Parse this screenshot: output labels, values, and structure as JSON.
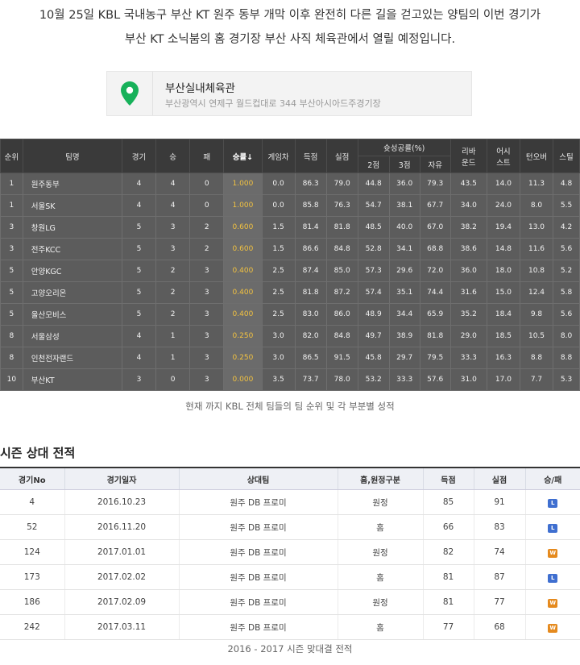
{
  "intro": {
    "line1": "10월 25일 KBL 국내농구 부산 KT 원주 동부 개막 이후 완전히 다른 길을 걷고있는 양팀의 이번 경기가",
    "line2": "부산 KT 소닉붐의 홈 경기장 부산 사직 체육관에서 열릴 예정입니다."
  },
  "venue": {
    "icon": "map-pin-icon",
    "name": "부산실내체육관",
    "address": "부산광역시 연제구 월드컵대로 344 부산아시아드주경기장"
  },
  "standings": {
    "headers": {
      "rank": "순위",
      "team": "팀명",
      "games": "경기",
      "wins": "승",
      "losses": "패",
      "pct": "승률↓",
      "gb": "게임차",
      "pf": "득점",
      "pa": "실점",
      "fg": "슛성공률(%)",
      "fg2": "2점",
      "fg3": "3점",
      "ft": "자유",
      "reb": "리바\n운드",
      "ast": "어시\n스트",
      "to": "턴오버",
      "stl": "스틸"
    },
    "rows": [
      [
        "1",
        "원주동부",
        "4",
        "4",
        "0",
        "1.000",
        "0.0",
        "86.3",
        "79.0",
        "44.8",
        "36.0",
        "79.3",
        "43.5",
        "14.0",
        "11.3",
        "4.8"
      ],
      [
        "1",
        "서울SK",
        "4",
        "4",
        "0",
        "1.000",
        "0.0",
        "85.8",
        "76.3",
        "54.7",
        "38.1",
        "67.7",
        "34.0",
        "24.0",
        "8.0",
        "5.5"
      ],
      [
        "3",
        "창원LG",
        "5",
        "3",
        "2",
        "0.600",
        "1.5",
        "81.4",
        "81.8",
        "48.5",
        "40.0",
        "67.0",
        "38.2",
        "19.4",
        "13.0",
        "4.2"
      ],
      [
        "3",
        "전주KCC",
        "5",
        "3",
        "2",
        "0.600",
        "1.5",
        "86.6",
        "84.8",
        "52.8",
        "34.1",
        "68.8",
        "38.6",
        "14.8",
        "11.6",
        "5.6"
      ],
      [
        "5",
        "안양KGC",
        "5",
        "2",
        "3",
        "0.400",
        "2.5",
        "87.4",
        "85.0",
        "57.3",
        "29.6",
        "72.0",
        "36.0",
        "18.0",
        "10.8",
        "5.2"
      ],
      [
        "5",
        "고양오리온",
        "5",
        "2",
        "3",
        "0.400",
        "2.5",
        "81.8",
        "87.2",
        "57.4",
        "35.1",
        "74.4",
        "31.6",
        "15.0",
        "12.4",
        "5.8"
      ],
      [
        "5",
        "울산모비스",
        "5",
        "2",
        "3",
        "0.400",
        "2.5",
        "83.0",
        "86.0",
        "48.9",
        "34.4",
        "65.9",
        "35.2",
        "18.4",
        "9.8",
        "5.6"
      ],
      [
        "8",
        "서울삼성",
        "4",
        "1",
        "3",
        "0.250",
        "3.0",
        "82.0",
        "84.8",
        "49.7",
        "38.9",
        "81.8",
        "29.0",
        "18.5",
        "10.5",
        "8.0"
      ],
      [
        "8",
        "인천전자랜드",
        "4",
        "1",
        "3",
        "0.250",
        "3.0",
        "86.5",
        "91.5",
        "45.8",
        "29.7",
        "79.5",
        "33.3",
        "16.3",
        "8.8",
        "8.8"
      ],
      [
        "10",
        "부산KT",
        "3",
        "0",
        "3",
        "0.000",
        "3.5",
        "73.7",
        "78.0",
        "53.2",
        "33.3",
        "57.6",
        "31.0",
        "17.0",
        "7.7",
        "5.3"
      ]
    ],
    "caption": "현재 까지 KBL 전체 팀들의 팀 순위 및 각 부분별 성적"
  },
  "h2h": {
    "title": "시즌 상대 전적",
    "headers": [
      "경기No",
      "경기일자",
      "상대팀",
      "홈,원정구분",
      "득점",
      "실점",
      "승/패"
    ],
    "rows": [
      {
        "no": "4",
        "date": "2016.10.23",
        "opp": "원주 DB 프로미",
        "ha": "원정",
        "pf": "85",
        "pa": "91",
        "res": "L"
      },
      {
        "no": "52",
        "date": "2016.11.20",
        "opp": "원주 DB 프로미",
        "ha": "홈",
        "pf": "66",
        "pa": "83",
        "res": "L"
      },
      {
        "no": "124",
        "date": "2017.01.01",
        "opp": "원주 DB 프로미",
        "ha": "원정",
        "pf": "82",
        "pa": "74",
        "res": "W"
      },
      {
        "no": "173",
        "date": "2017.02.02",
        "opp": "원주 DB 프로미",
        "ha": "홈",
        "pf": "81",
        "pa": "87",
        "res": "L"
      },
      {
        "no": "186",
        "date": "2017.02.09",
        "opp": "원주 DB 프로미",
        "ha": "원정",
        "pf": "81",
        "pa": "77",
        "res": "W"
      },
      {
        "no": "242",
        "date": "2017.03.11",
        "opp": "원주 DB 프로미",
        "ha": "홈",
        "pf": "77",
        "pa": "68",
        "res": "W"
      }
    ],
    "caption": "2016 - 2017 시즌 맞대결 전적"
  },
  "colors": {
    "win": "#e58a1e",
    "loss": "#3f6fd0",
    "pin": "#17b15a",
    "pct": "#f2c240"
  }
}
